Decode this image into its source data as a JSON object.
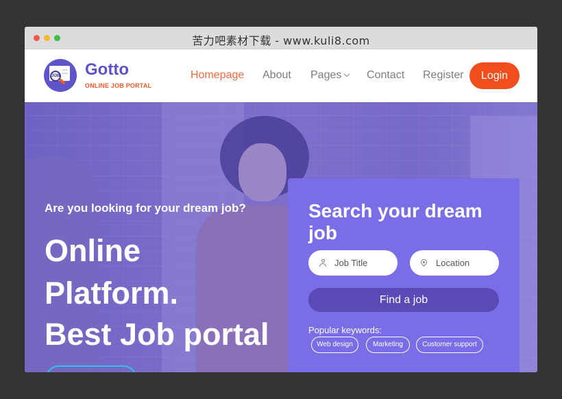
{
  "window": {
    "title": "苦力吧素材下载 - www.kuli8.com"
  },
  "brand": {
    "name": "Gotto",
    "tagline": "ONLINE JOB PORTAL",
    "logo_text": "JOB"
  },
  "nav": {
    "items": [
      {
        "label": "Homepage",
        "active": true
      },
      {
        "label": "About"
      },
      {
        "label": "Pages",
        "has_dropdown": true
      },
      {
        "label": "Contact"
      },
      {
        "label": "Register"
      }
    ],
    "login_label": "Login"
  },
  "hero": {
    "subtitle": "Are you looking for your dream job?",
    "headline": [
      "Online",
      "Platform.",
      "Best Job portal"
    ]
  },
  "search": {
    "title": "Search your dream job",
    "job_title_placeholder": "Job Title",
    "location_placeholder": "Location",
    "submit_label": "Find a job",
    "keywords_label": "Popular keywords:",
    "keywords": [
      "Web design",
      "Marketing",
      "Customer support"
    ]
  },
  "colors": {
    "accent": "#f14e1d",
    "brand": "#5a52c6",
    "card": "#7a6ee6",
    "button": "#5a4ab6",
    "nav_active": "#ee6a3e"
  }
}
